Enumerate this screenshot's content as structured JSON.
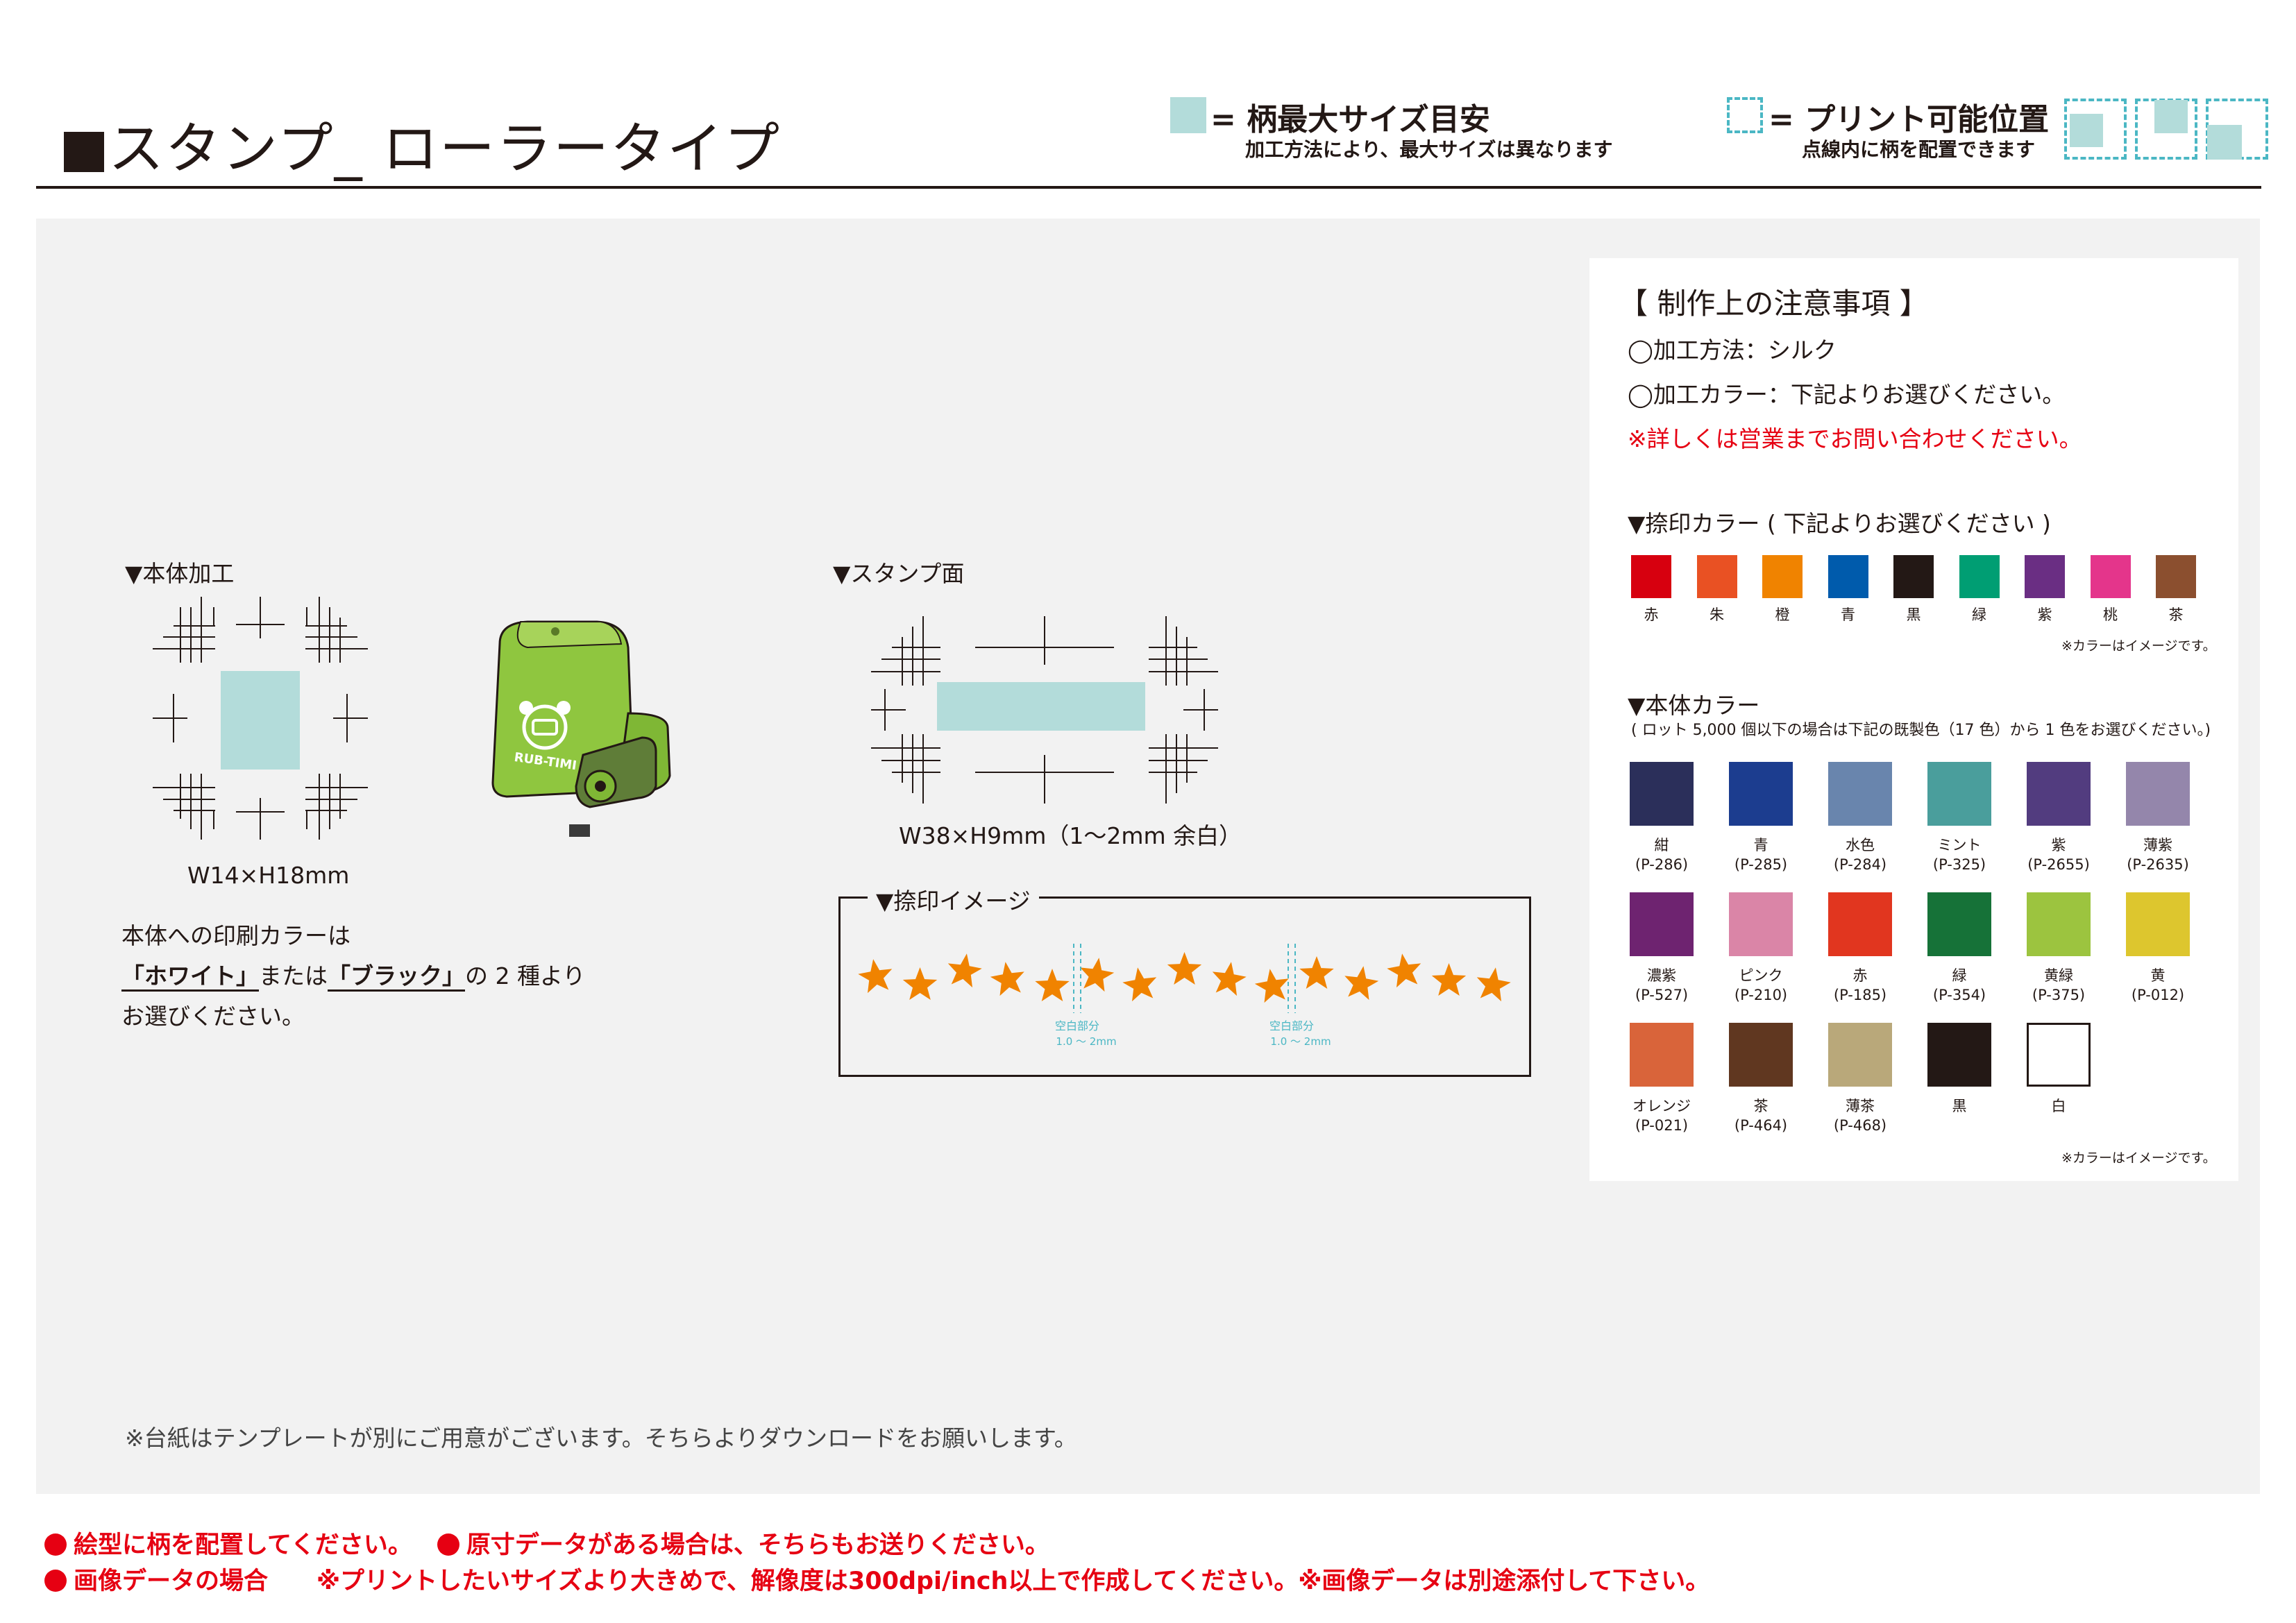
{
  "header": {
    "title": "スタンプ_ ローラータイプ",
    "legend_max": {
      "main": "= 柄最大サイズ目安",
      "sub": "加工方法により、最大サイズは異なります"
    },
    "legend_print": {
      "main": "= プリント可能位置",
      "sub": "点線内に柄を配置できます"
    }
  },
  "body_section": {
    "heading": "▼本体加工",
    "size": "W14×H18mm",
    "note_line1": "本体への印刷カラーは",
    "note_white": "「ホワイト」",
    "note_mid": "または",
    "note_black": "「ブラック」",
    "note_end": "の 2 種より",
    "note_line3": "お選びください。"
  },
  "product": {
    "logo_text": "RUB-TIMI"
  },
  "stamp_section": {
    "heading": "▼スタンプ面",
    "size": "W38×H9mm（1〜2mm 余白）"
  },
  "impression": {
    "heading": "▼捺印イメージ",
    "gap_label": "空白部分",
    "gap_value": "1.0 〜 2mm",
    "star_color": "#f08300",
    "star_count": 15
  },
  "notes": {
    "title": "【 制作上の注意事項 】",
    "method": "◯加工方法：シルク",
    "color": "◯加工カラー：下記よりお選びください。",
    "contact": "※詳しくは営業までお問い合わせください。",
    "ink_heading": "▼捺印カラー ( 下記よりお選びください )",
    "ink_colors": [
      {
        "name": "赤",
        "hex": "#d7000f"
      },
      {
        "name": "朱",
        "hex": "#e95123"
      },
      {
        "name": "橙",
        "hex": "#f08300"
      },
      {
        "name": "青",
        "hex": "#005bac"
      },
      {
        "name": "黒",
        "hex": "#231815"
      },
      {
        "name": "緑",
        "hex": "#009e73"
      },
      {
        "name": "紫",
        "hex": "#6a2e83"
      },
      {
        "name": "桃",
        "hex": "#e4358b"
      },
      {
        "name": "茶",
        "hex": "#8b4f2f"
      }
    ],
    "image_note": "※カラーはイメージです。",
    "body_heading": "▼本体カラー",
    "body_sub": "( ロット 5,000 個以下の場合は下記の既製色（17 色）から 1 色をお選びください。)",
    "body_colors": [
      {
        "name": "紺",
        "code": "(P-286)",
        "hex": "#2b2f5a"
      },
      {
        "name": "青",
        "code": "(P-285)",
        "hex": "#1c3d8f"
      },
      {
        "name": "水色",
        "code": "(P-284)",
        "hex": "#6985ad"
      },
      {
        "name": "ミント",
        "code": "(P-325)",
        "hex": "#4a9e9c"
      },
      {
        "name": "紫",
        "code": "(P-2655)",
        "hex": "#523c7f"
      },
      {
        "name": "薄紫",
        "code": "(P-2635)",
        "hex": "#9486ab"
      },
      {
        "name": "濃紫",
        "code": "(P-527)",
        "hex": "#6e2370"
      },
      {
        "name": "ピンク",
        "code": "(P-210)",
        "hex": "#da85a7"
      },
      {
        "name": "赤",
        "code": "(P-185)",
        "hex": "#e1361f"
      },
      {
        "name": "緑",
        "code": "(P-354)",
        "hex": "#167238"
      },
      {
        "name": "黄緑",
        "code": "(P-375)",
        "hex": "#9cc43f"
      },
      {
        "name": "黄",
        "code": "(P-012)",
        "hex": "#ddc62e"
      },
      {
        "name": "オレンジ",
        "code": "(P-021)",
        "hex": "#d9643a"
      },
      {
        "name": "茶",
        "code": "(P-464)",
        "hex": "#603720"
      },
      {
        "name": "薄茶",
        "code": "(P-468)",
        "hex": "#b9a87a"
      },
      {
        "name": "黒",
        "code": "",
        "hex": "#231815"
      },
      {
        "name": "白",
        "code": "",
        "hex": "#ffffff"
      }
    ]
  },
  "template_note": "※台紙はテンプレートが別にご用意がございます。そちらよりダウンロードをお願いします。",
  "footer": {
    "line1a": "絵型に柄を配置してください。",
    "line1b": "原寸データがある場合は、そちらもお送りください。",
    "line2a": "画像データの場合",
    "line2b": "※プリントしたいサイズより大きめで、解像度は300dpi/inch以上で作成してください。※画像データは別途添付して下さい。"
  },
  "colors": {
    "accent_red": "#e60012",
    "swatch_blue": "#b3dcda",
    "dash_teal": "#4bb7c4",
    "body_green": "#8fc63f"
  }
}
